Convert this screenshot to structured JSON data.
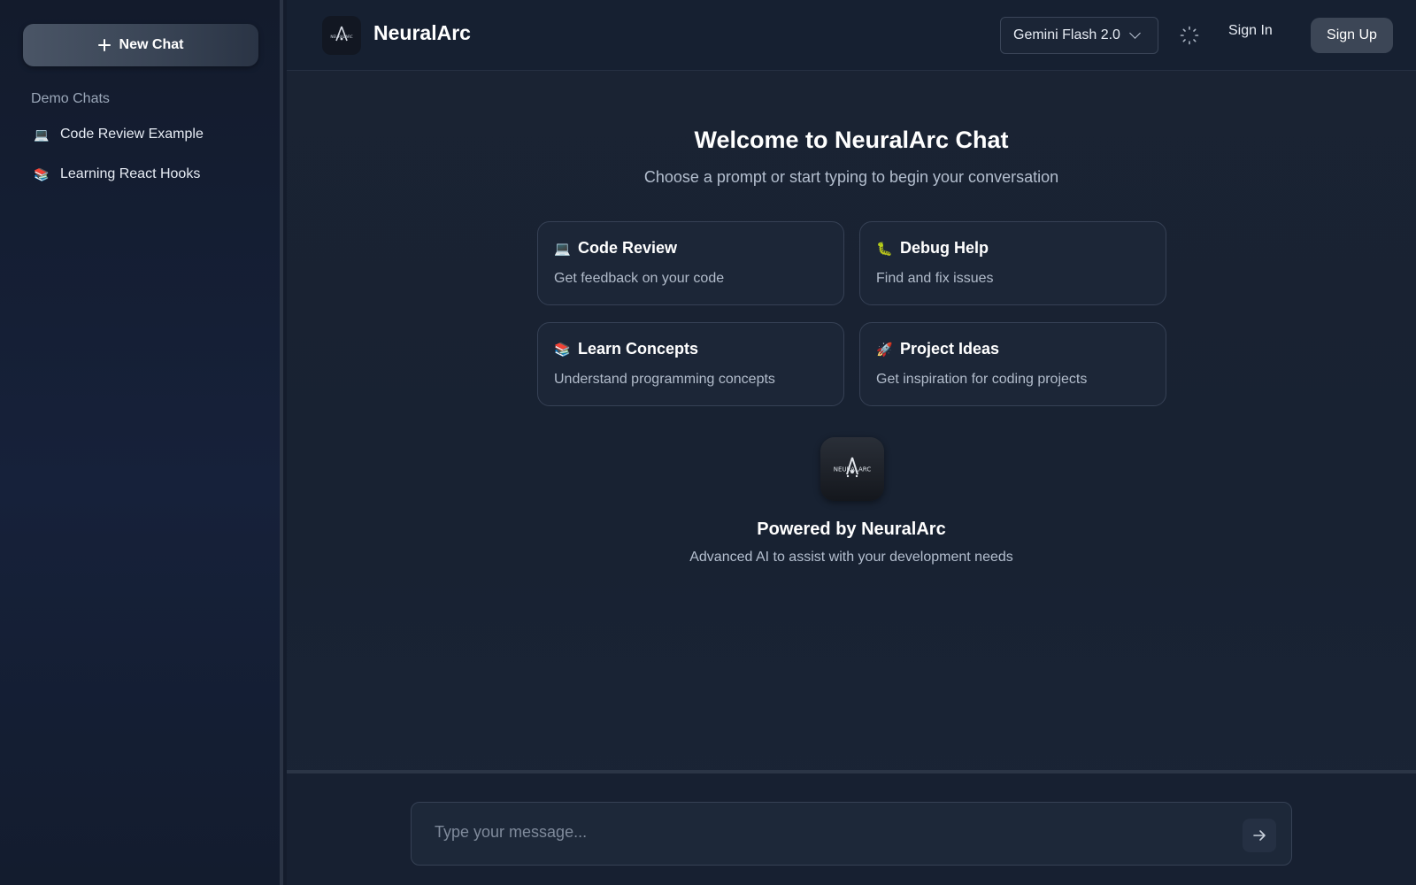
{
  "sidebar": {
    "new_chat_label": "New Chat",
    "section_title": "Demo Chats",
    "items": [
      {
        "icon": "laptop-icon",
        "emoji": "💻",
        "label": "Code Review Example"
      },
      {
        "icon": "books-icon",
        "emoji": "📚",
        "label": "Learning React Hooks"
      }
    ]
  },
  "header": {
    "brand": "NeuralArc",
    "logo_text": "NEURALARC",
    "model_selected": "Gemini Flash 2.0",
    "sign_in": "Sign In",
    "sign_up": "Sign Up"
  },
  "welcome": {
    "title": "Welcome to NeuralArc Chat",
    "subtitle": "Choose a prompt or start typing to begin your conversation"
  },
  "cards": [
    {
      "icon": "laptop-icon",
      "emoji": "💻",
      "title": "Code Review",
      "desc": "Get feedback on your code"
    },
    {
      "icon": "bug-icon",
      "emoji": "🐛",
      "title": "Debug Help",
      "desc": "Find and fix issues"
    },
    {
      "icon": "books-icon",
      "emoji": "📚",
      "title": "Learn Concepts",
      "desc": "Understand programming concepts"
    },
    {
      "icon": "rocket-icon",
      "emoji": "🚀",
      "title": "Project Ideas",
      "desc": "Get inspiration for coding projects"
    }
  ],
  "powered": {
    "title": "Powered by NeuralArc",
    "subtitle": "Advanced AI to assist with your development needs"
  },
  "composer": {
    "placeholder": "Type your message..."
  },
  "colors": {
    "background": "#182232",
    "sidebar": "#141d30",
    "card_border": "#364155",
    "accent_button": "#3c4656"
  }
}
